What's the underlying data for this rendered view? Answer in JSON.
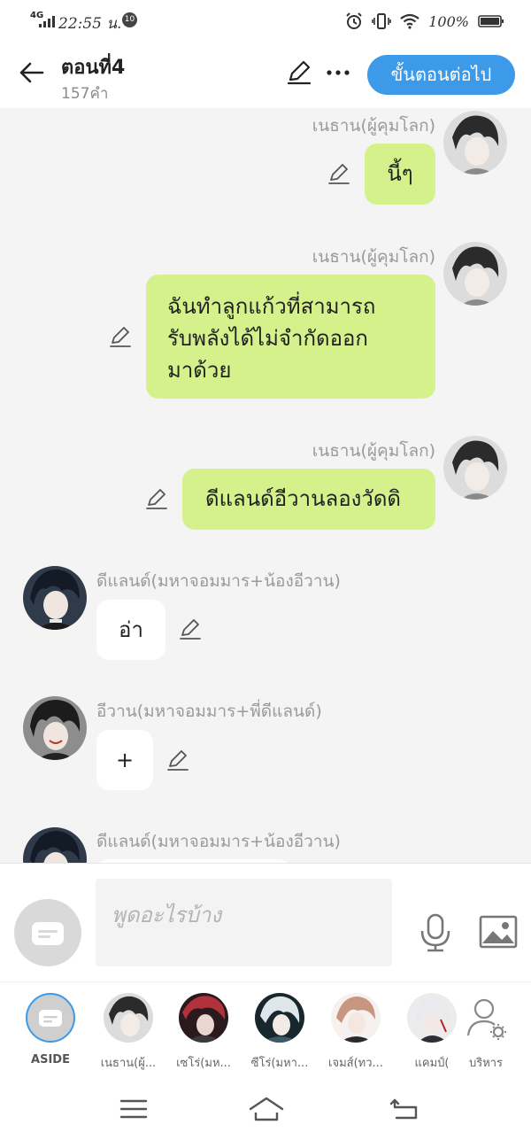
{
  "status_bar": {
    "network": "4G",
    "time": "22:55 น.",
    "notification_count": "10",
    "battery": "100%"
  },
  "header": {
    "title": "ตอนที่4",
    "word_count": "157คำ",
    "next_button_label": "ขั้นตอนต่อไป"
  },
  "messages": [
    {
      "side": "right",
      "sender": "เนธาน(ผู้คุมโลก)",
      "lines": [
        "นี้ๆ"
      ]
    },
    {
      "side": "right",
      "sender": "เนธาน(ผู้คุมโลก)",
      "lines": [
        "ฉันทำลูกแก้วที่สามารถ",
        "รับพลังได้ไม่จำกัดออก",
        "มาด้วย"
      ]
    },
    {
      "side": "right",
      "sender": "เนธาน(ผู้คุมโลก)",
      "lines": [
        "ดีแลนด์อีวานลองวัดดิ"
      ]
    },
    {
      "side": "left",
      "sender": "ดีแลนด์(มหาจอมมาร+น้องอีวาน)",
      "lines": [
        "อ่า"
      ]
    },
    {
      "side": "left",
      "sender": "อีวาน(มหาจอมมาร+พี่ดีแลนด์)",
      "lines": [
        "+"
      ]
    },
    {
      "side": "left",
      "sender": "ดีแลนด์(มหาจอมมาร+น้องอีวาน)",
      "lines": []
    }
  ],
  "composer": {
    "placeholder": "พูดอะไรบ้าง"
  },
  "characters": [
    {
      "label": "ASIDE"
    },
    {
      "label": "เนธาน(ผู้..."
    },
    {
      "label": "เซโร่(มห..."
    },
    {
      "label": "ซีโร่(มหา..."
    },
    {
      "label": "เจมส์(ทว..."
    },
    {
      "label": "แคมป์("
    },
    {
      "label": "บริหาร"
    }
  ],
  "colors": {
    "accent": "#3d9ae8",
    "bubble_right": "#d4f18c",
    "bubble_left": "#ffffff",
    "background": "#f4f4f4"
  }
}
